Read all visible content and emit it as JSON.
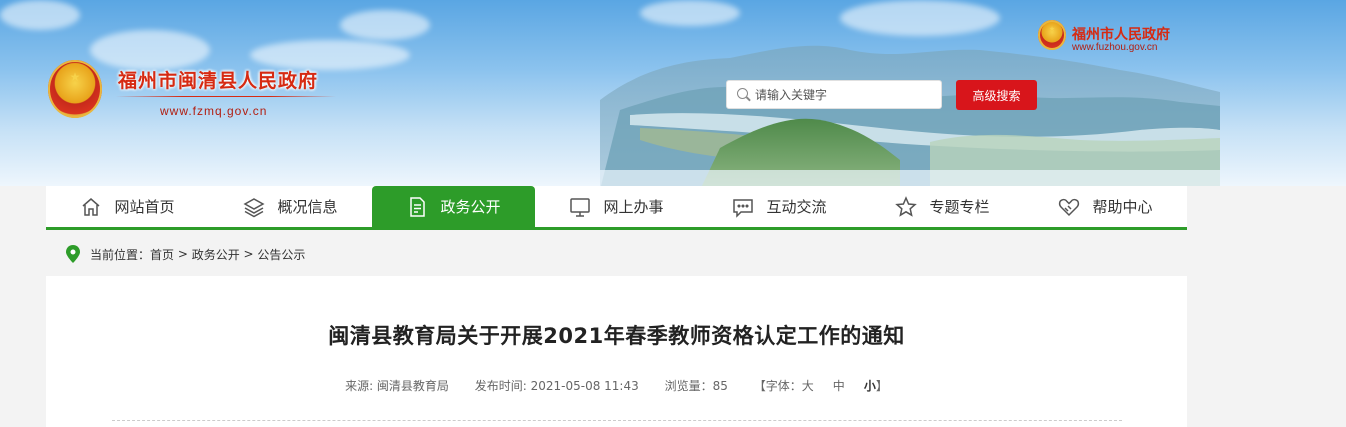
{
  "header": {
    "site_title": "福州市闽清县人民政府",
    "site_url": "www.fzmq.gov.cn",
    "parent_title": "福州市人民政府",
    "parent_url": "www.fuzhou.gov.cn",
    "search_placeholder": "请输入关键字",
    "advanced_search_label": "高级搜索"
  },
  "nav": {
    "items": [
      {
        "label": "网站首页",
        "icon": "home-icon"
      },
      {
        "label": "概况信息",
        "icon": "layers-icon"
      },
      {
        "label": "政务公开",
        "icon": "document-icon",
        "active": true
      },
      {
        "label": "网上办事",
        "icon": "monitor-icon"
      },
      {
        "label": "互动交流",
        "icon": "chat-icon"
      },
      {
        "label": "专题专栏",
        "icon": "star-icon"
      },
      {
        "label": "帮助中心",
        "icon": "handshake-icon"
      }
    ],
    "active_color": "#2d9c29"
  },
  "breadcrumb": {
    "prefix": "当前位置：",
    "items": [
      "首页",
      "政务公开",
      "公告公示"
    ],
    "separator": " > "
  },
  "article": {
    "title": "闽清县教育局关于开展2021年春季教师资格认定工作的通知",
    "source": "来源: 闽清县教育局",
    "publish_time": "发布时间: 2021-05-08 11:43",
    "views": "浏览量：85",
    "font_size_label": "【字体：",
    "font_large": "大",
    "font_medium": "中",
    "font_small": "小",
    "font_size_close": "】"
  },
  "colors": {
    "brand_red": "#d62a12",
    "search_button": "#d8151b",
    "nav_green": "#2d9c29"
  }
}
